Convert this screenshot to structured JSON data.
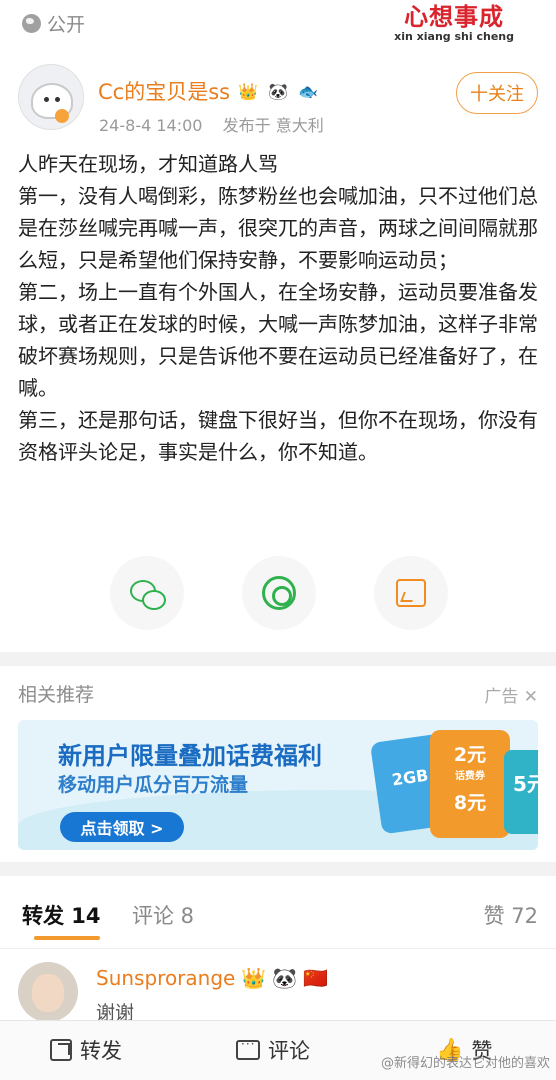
{
  "top": {
    "visibility": "公开",
    "logo_cn": "心想事成",
    "logo_en": "xin xiang shi cheng"
  },
  "post": {
    "username": "Cc的宝贝是ss",
    "badges": [
      "👑",
      "🐼",
      "🐟"
    ],
    "time": "24-8-4 14:00",
    "location": "发布于 意大利",
    "follow_label": "十关注",
    "content": "人昨天在现场，才知道路人骂\n第一，没有人喝倒彩，陈梦粉丝也会喊加油，只不过他们总是在莎丝喊完再喊一声，很突兀的声音，两球之间间隔就那么短，只是希望他们保持安静，不要影响运动员；\n第二，场上一直有个外国人，在全场安静，运动员要准备发球，或者正在发球的时候，大喊一声陈梦加油，这样子非常破坏赛场规则，只是告诉他不要在运动员已经准备好了，在喊。\n第三，还是那句话，键盘下很好当，但你不在现场，你没有资格评头论足，事实是什么，你不知道。"
  },
  "share_icons": [
    "wechat-icon",
    "moments-icon",
    "save-image-icon"
  ],
  "recommend": {
    "heading": "相关推荐",
    "ad_label": "广告",
    "ad_close": "✕",
    "banner": {
      "title": "新用户限量叠加话费福利",
      "subtitle": "移动用户瓜分百万流量",
      "button": "点击领取 >",
      "card_blue": "2GB",
      "card_orange_1": "2元",
      "card_orange_1_sub": "话费券",
      "card_orange_2": "8元",
      "card_teal": "5元"
    }
  },
  "tabs": {
    "repost": "转发 14",
    "comment": "评论 8",
    "like": "赞 72"
  },
  "repost_item": {
    "username": "Sunsprorange",
    "badges": [
      "👑",
      "🐼",
      "🇨🇳"
    ],
    "text": "谢谢"
  },
  "bottom_bar": {
    "repost": "转发",
    "comment": "评论",
    "like": "赞"
  },
  "watermark": "@新得幻的表达它对他的喜欢",
  "colors": {
    "accent": "#ea7d1e",
    "tab_underline": "#f29a2e",
    "wechat_green": "#2fb24e",
    "banner_blue": "#1877d2"
  }
}
